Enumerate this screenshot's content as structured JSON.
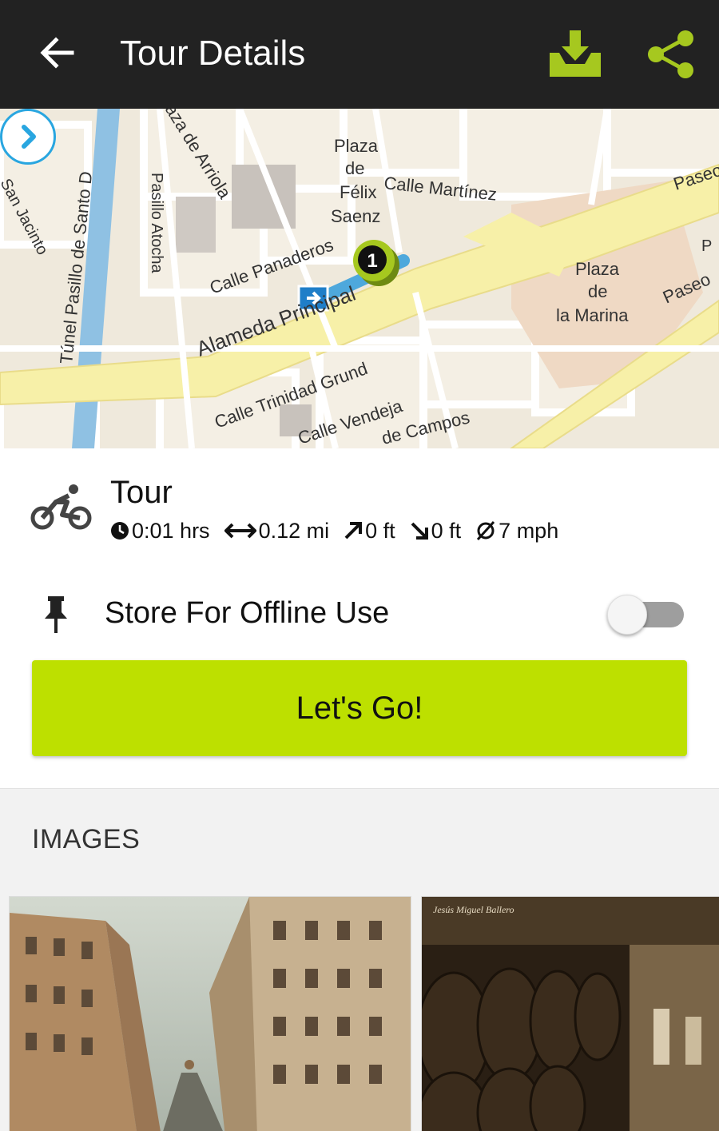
{
  "appbar": {
    "title": "Tour Details",
    "icons": [
      "back-arrow-icon",
      "download-icon",
      "share-icon"
    ],
    "accent": "#a6c81f"
  },
  "map": {
    "labels": {
      "plaza_felix_1": "Plaza",
      "plaza_felix_2": "de",
      "plaza_felix_3": "Félix",
      "plaza_felix_4": "Saenz",
      "calle_martinez": "Calle Martínez",
      "calle_panaderos": "Calle Panaderos",
      "alameda": "Alameda Principal",
      "plaza_marina_1": "Plaza",
      "plaza_marina_2": "de",
      "plaza_marina_3": "la Marina",
      "paseo_1": "Paseo",
      "paseo_2": "Paseo",
      "calle_trinidad": "Calle Trinidad Grund",
      "calle_vendeja": "Calle Vendeja",
      "campos": "de Campos",
      "tunel": "Túnel Pasillo de Santo D",
      "pasillo_atocha": "Pasillo Atocha",
      "plaza_arriola": "aza de Arriola",
      "san_jacinto": "San Jacinto",
      "marker": "1",
      "p": "P"
    },
    "water_color": "#8fc1e3",
    "road_color": "#f7f0a8",
    "route_color": "#4ea8dc"
  },
  "tour": {
    "name": "Tour",
    "activity_icon": "bicycle-icon",
    "stats": {
      "duration": "0:01 hrs",
      "distance": "0.12 mi",
      "ascent": "0 ft",
      "descent": "0 ft",
      "avg_speed": "7 mph"
    }
  },
  "offline": {
    "label": "Store For Offline Use",
    "enabled": false
  },
  "go_button": {
    "label": "Let's Go!",
    "color": "#bde000"
  },
  "images": {
    "title": "IMAGES",
    "items": [
      {
        "name": "street-photo"
      },
      {
        "name": "wine-cellar-photo",
        "caption": "Jesús Miguel Ballero"
      }
    ]
  }
}
